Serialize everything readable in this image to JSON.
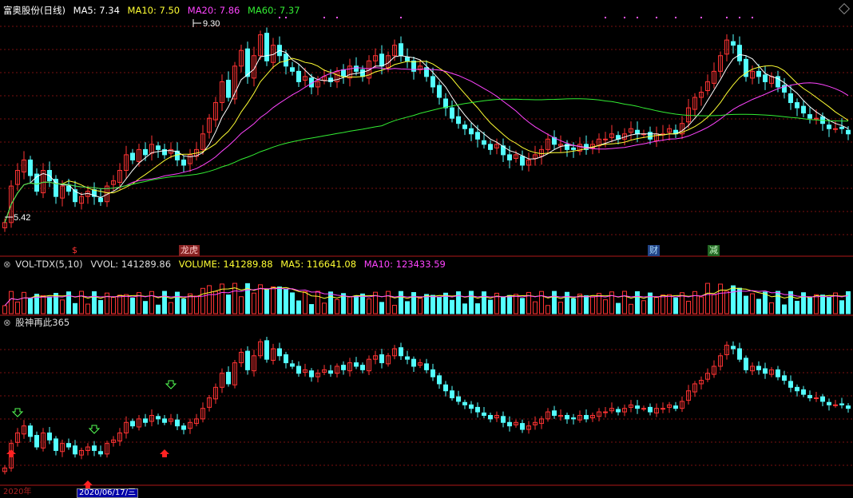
{
  "stock": {
    "name": "富奥股份",
    "period": "(日线)"
  },
  "ma_legend": [
    {
      "label": "MA5: 7.34",
      "color": "#ffffff"
    },
    {
      "label": "MA10: 7.50",
      "color": "#ffff33"
    },
    {
      "label": "MA20: 7.86",
      "color": "#ff44ff"
    },
    {
      "label": "MA60: 7.37",
      "color": "#33ee33"
    }
  ],
  "price_high_label": "9.30",
  "price_low_label": "5.42",
  "markers": [
    {
      "text": "$",
      "color": "#ff3333",
      "bg": "transparent"
    },
    {
      "text": "龙虎",
      "color": "#ffcccc",
      "bg": "#882222"
    },
    {
      "text": "财",
      "color": "#aaddff",
      "bg": "#224488"
    },
    {
      "text": "减",
      "color": "#ccffcc",
      "bg": "#226622"
    }
  ],
  "vol_legend": {
    "name": "VOL-TDX(5,10)",
    "vvol": "VVOL: 141289.86",
    "volume": "VOLUME: 141289.88",
    "ma5": "MA5: 116641.08",
    "ma10": "MA10: 123433.59"
  },
  "indicator_legend": {
    "name": "股神再此365"
  },
  "date_label": "2020/06/17/三",
  "axis_label": "2020年",
  "colors": {
    "up": "#ff3333",
    "down": "#54ffff",
    "grid": "#7a1010",
    "divider": "#b01818",
    "ma5": "#ffffff",
    "ma10": "#ffff33",
    "ma20": "#ff44ff",
    "ma60": "#33ee33",
    "signal_down": "#55ff55",
    "signal_up": "#ff2222"
  },
  "chart_data": {
    "type": "candlestick",
    "price_range": [
      5.2,
      9.5
    ],
    "closes": [
      5.6,
      6.3,
      6.6,
      6.8,
      6.5,
      6.2,
      6.6,
      6.4,
      6.1,
      6.3,
      6.2,
      6.0,
      6.1,
      6.2,
      6.1,
      6.0,
      6.3,
      6.4,
      6.6,
      6.9,
      6.8,
      7.0,
      6.9,
      7.1,
      7.0,
      6.9,
      7.0,
      6.8,
      6.7,
      6.9,
      7.0,
      7.3,
      7.6,
      7.9,
      8.3,
      8.0,
      8.6,
      8.9,
      8.4,
      8.8,
      9.2,
      8.7,
      9.0,
      8.8,
      8.6,
      8.5,
      8.3,
      8.4,
      8.2,
      8.3,
      8.4,
      8.3,
      8.5,
      8.4,
      8.6,
      8.5,
      8.4,
      8.7,
      8.8,
      8.6,
      8.8,
      9.0,
      8.8,
      8.7,
      8.5,
      8.6,
      8.4,
      8.2,
      8.0,
      7.8,
      7.6,
      7.5,
      7.4,
      7.3,
      7.2,
      7.1,
      7.0,
      7.1,
      6.9,
      6.8,
      6.9,
      6.7,
      6.8,
      6.9,
      7.0,
      7.2,
      7.1,
      7.1,
      7.0,
      7.0,
      7.1,
      7.0,
      7.1,
      7.2,
      7.2,
      7.3,
      7.2,
      7.3,
      7.4,
      7.3,
      7.3,
      7.2,
      7.3,
      7.3,
      7.4,
      7.3,
      7.5,
      7.8,
      8.0,
      8.1,
      8.3,
      8.5,
      8.8,
      9.1,
      9.0,
      8.7,
      8.4,
      8.5,
      8.4,
      8.3,
      8.4,
      8.2,
      8.1,
      7.9,
      7.8,
      7.7,
      7.6,
      7.6,
      7.5,
      7.4,
      7.4,
      7.4,
      7.3
    ]
  }
}
